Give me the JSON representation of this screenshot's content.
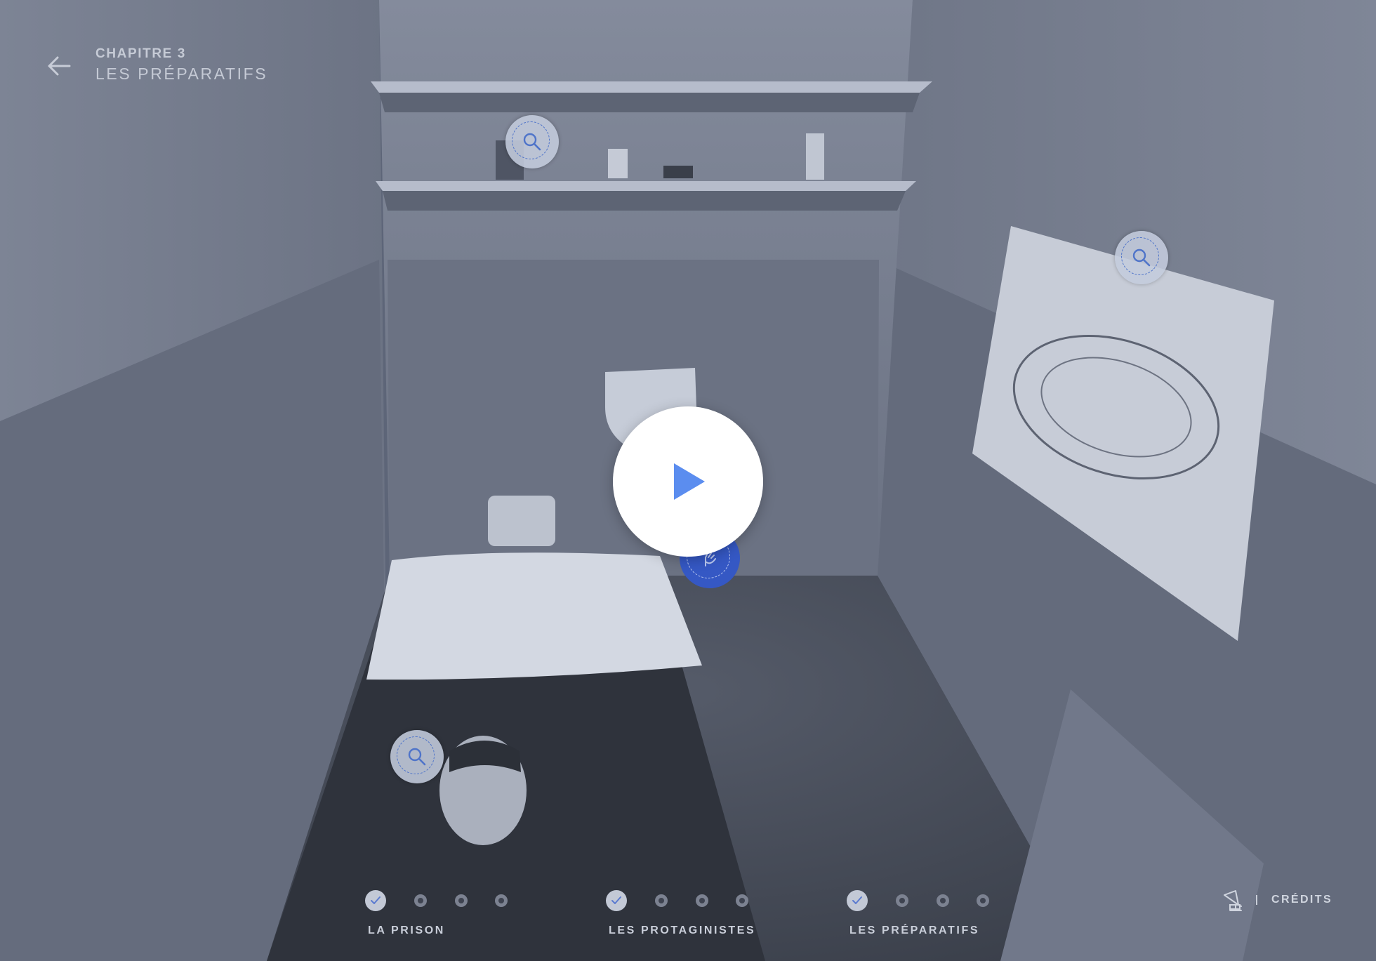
{
  "header": {
    "chapter_label": "CHAPITRE 3",
    "chapter_title": "LES PRÉPARATIFS",
    "back_icon": "arrow-left-icon"
  },
  "hotspots": [
    {
      "name": "shelf-items",
      "icon": "magnifier-icon"
    },
    {
      "name": "wall-map",
      "icon": "magnifier-icon"
    },
    {
      "name": "bed-dummy-head",
      "icon": "magnifier-icon"
    },
    {
      "name": "sink",
      "icon": "hand-icon",
      "active": true
    }
  ],
  "player": {
    "play_icon": "play-icon"
  },
  "progress": {
    "chapters": [
      {
        "name": "LA PRISON",
        "steps_completed": 1,
        "steps_total": 4
      },
      {
        "name": "LES PROTAGINISTES",
        "steps_completed": 1,
        "steps_total": 4
      },
      {
        "name": "LES PRÉPARATIFS",
        "steps_completed": 1,
        "steps_total": 4
      }
    ]
  },
  "footer": {
    "credits_label": "CRÉDITS",
    "sound_icon": "gramophone-icon"
  },
  "colors": {
    "accent": "#5b8def",
    "active_hotspot": "#3558c4",
    "overlay_text": "#c9ced9"
  }
}
